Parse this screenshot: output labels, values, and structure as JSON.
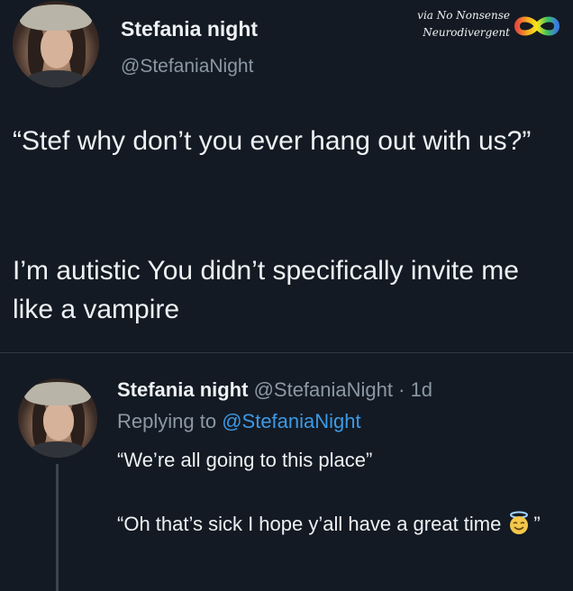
{
  "watermark": {
    "line1": "via No Nonsense",
    "line2": "Neurodivergent",
    "icon": "infinity-rainbow-icon"
  },
  "main_tweet": {
    "avatar": "profile-avatar",
    "display_name": "Stefania night",
    "handle": "@StefaniaNight",
    "text_1": "“Stef why don’t you ever hang out with us?”",
    "text_2": "I’m autistic You didn’t specifically invite me like a vampire"
  },
  "reply": {
    "avatar": "profile-avatar",
    "display_name": "Stefania night",
    "handle": "@StefaniaNight",
    "time": "· 1d",
    "replying_prefix": "Replying to",
    "replying_handle": "@StefaniaNight",
    "text_1": "“We’re all going to this place”",
    "text_2": "“Oh that’s sick I hope y’all have a great time",
    "text_2_end": "”",
    "emoji": "smiling-face-with-halo-emoji"
  },
  "colors": {
    "background": "#141a23",
    "text": "#eef1f4",
    "secondary_text": "#8b98a5",
    "link": "#3c9ae6"
  }
}
